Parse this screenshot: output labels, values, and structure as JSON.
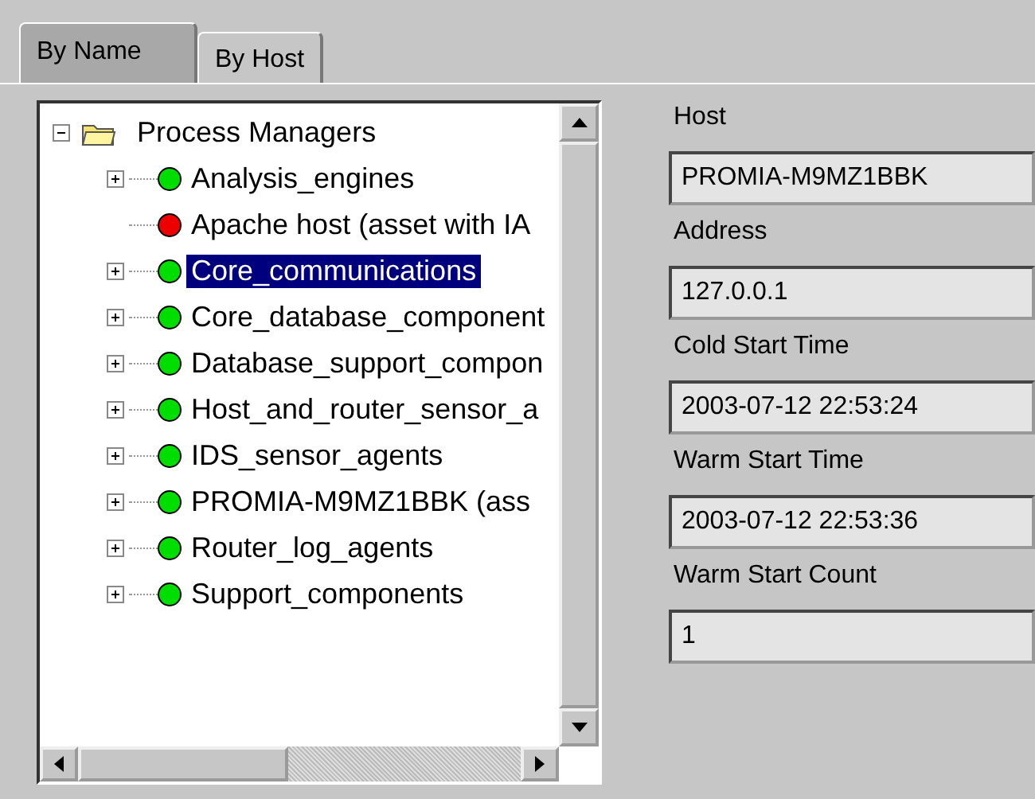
{
  "tabs": [
    {
      "label": "By Name",
      "selected": true
    },
    {
      "label": "By Host",
      "selected": false
    }
  ],
  "tree": {
    "label": "Process Managers",
    "expanded": true,
    "children": [
      {
        "label": "Analysis_engines",
        "kind": "group",
        "color": "#00dd00",
        "selected": false
      },
      {
        "label": "Apache host (asset with IA",
        "kind": "leaf",
        "color": "#ee0000",
        "selected": false
      },
      {
        "label": "Core_communications",
        "kind": "group",
        "color": "#00dd00",
        "selected": true
      },
      {
        "label": "Core_database_component",
        "kind": "group",
        "color": "#00dd00",
        "selected": false
      },
      {
        "label": "Database_support_compon",
        "kind": "group",
        "color": "#00dd00",
        "selected": false
      },
      {
        "label": "Host_and_router_sensor_a",
        "kind": "group",
        "color": "#00dd00",
        "selected": false
      },
      {
        "label": "IDS_sensor_agents",
        "kind": "group",
        "color": "#00dd00",
        "selected": false
      },
      {
        "label": "PROMIA-M9MZ1BBK (ass",
        "kind": "group",
        "color": "#00dd00",
        "selected": false
      },
      {
        "label": "Router_log_agents",
        "kind": "group",
        "color": "#00dd00",
        "selected": false
      },
      {
        "label": "Support_components",
        "kind": "group",
        "color": "#00dd00",
        "selected": false
      }
    ]
  },
  "details": [
    {
      "label": "Host",
      "value": "PROMIA-M9MZ1BBK"
    },
    {
      "label": "Address",
      "value": "127.0.0.1"
    },
    {
      "label": "Cold Start Time",
      "value": "2003-07-12 22:53:24"
    },
    {
      "label": "Warm Start Time",
      "value": "2003-07-12 22:53:36"
    },
    {
      "label": "Warm Start Count",
      "value": "1"
    }
  ]
}
